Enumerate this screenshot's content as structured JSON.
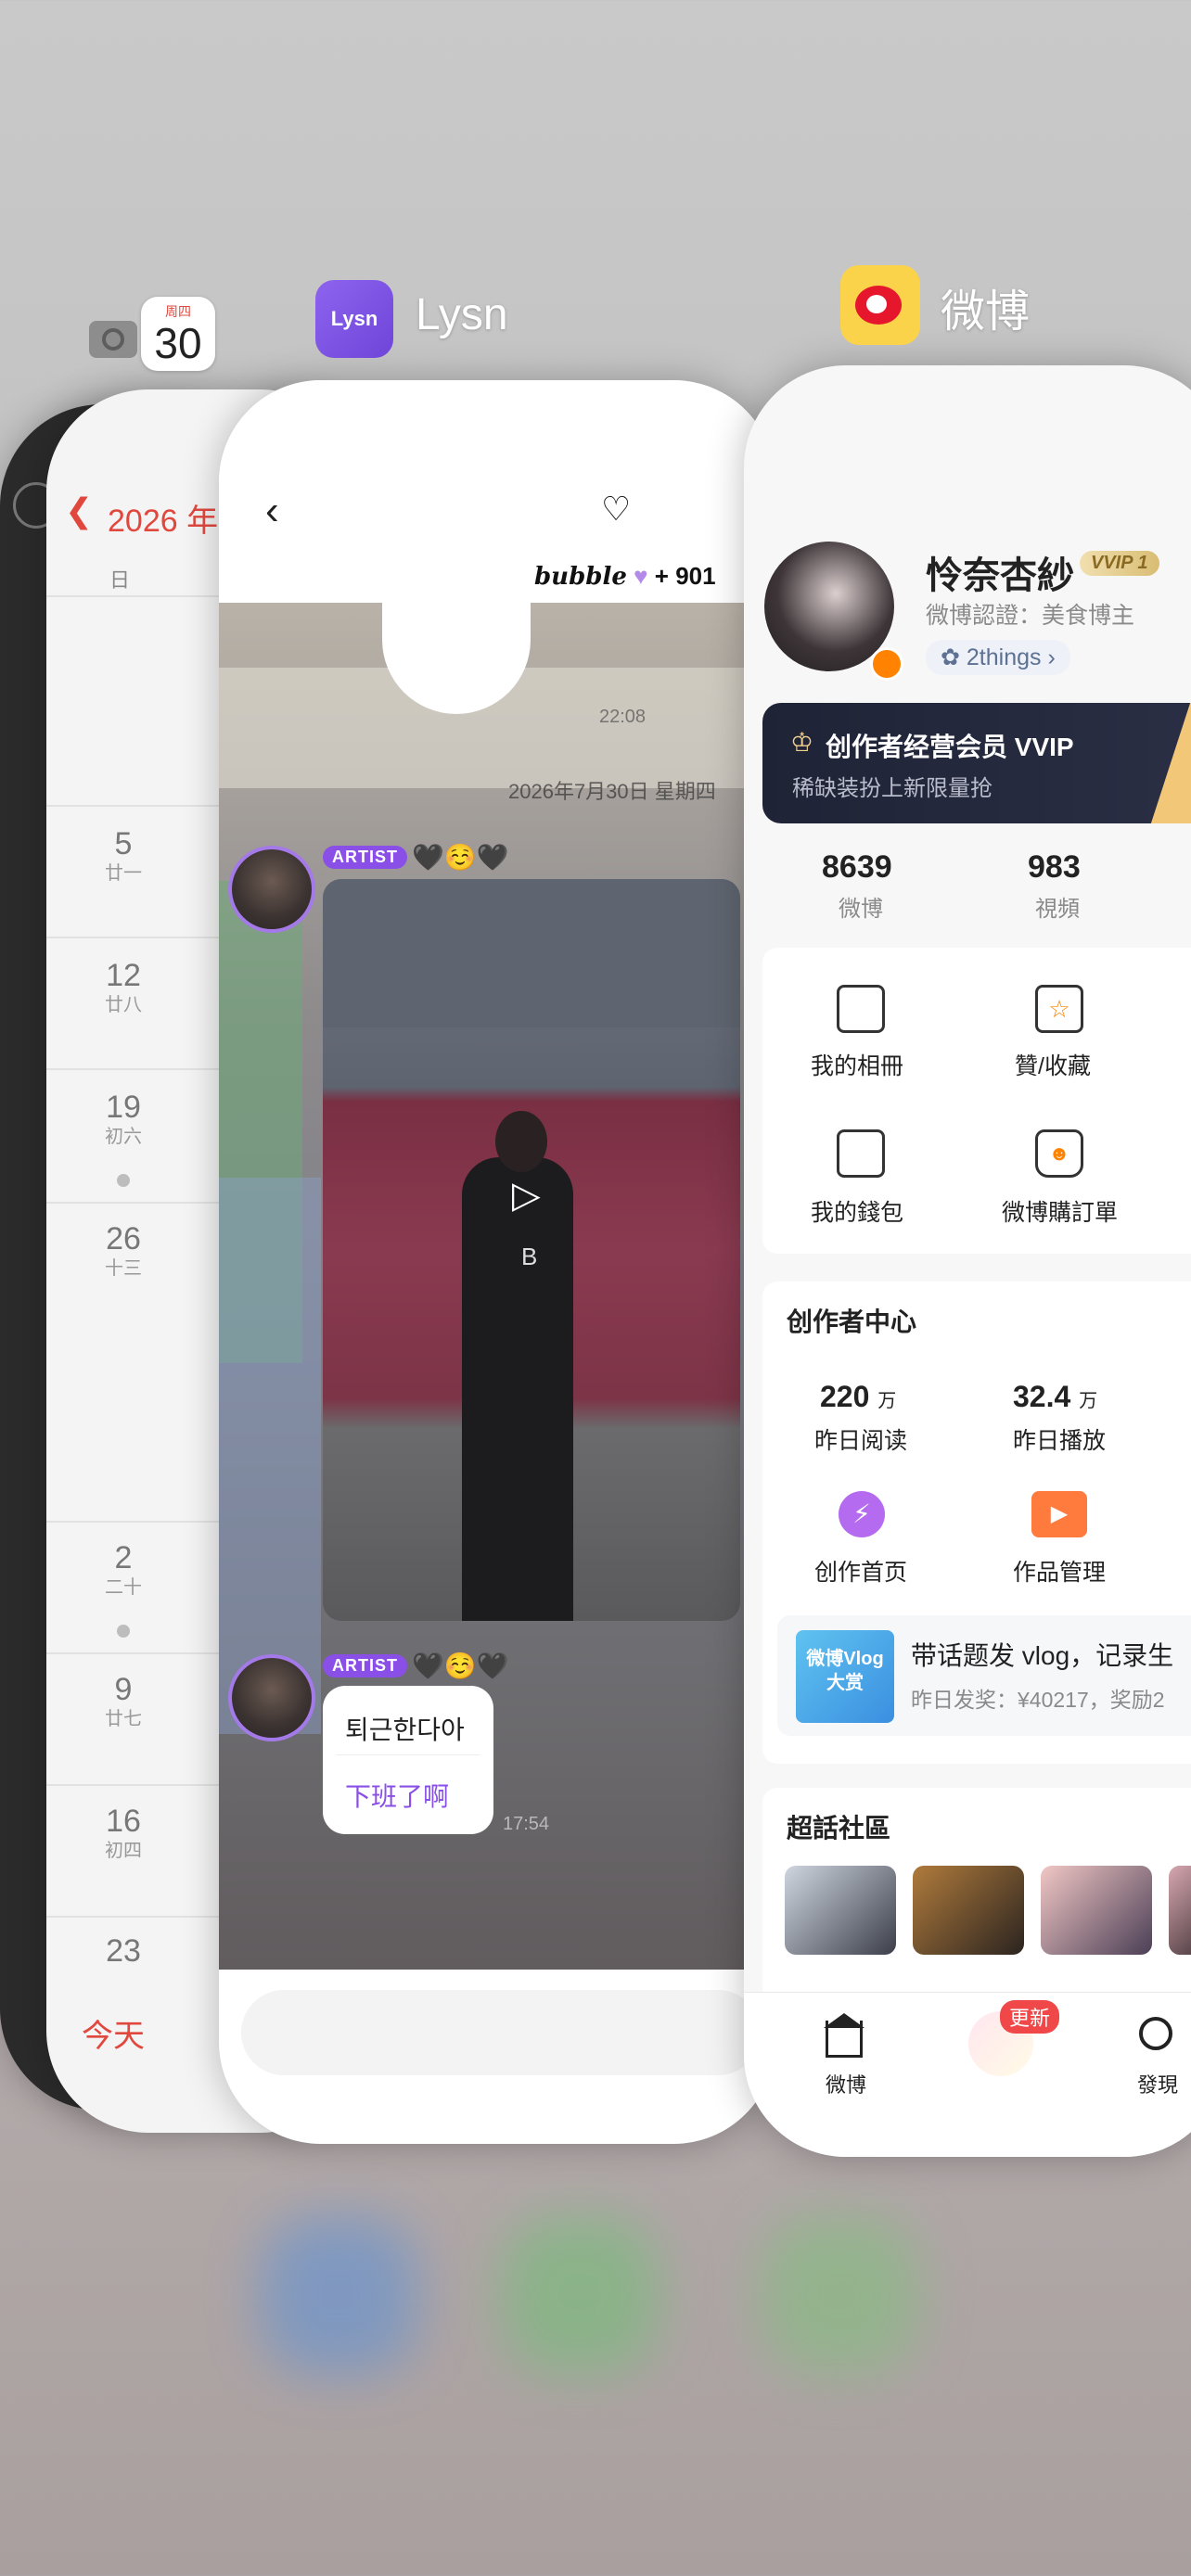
{
  "camera": {
    "app": "Camera"
  },
  "calendar": {
    "badge_weekday": "周四",
    "badge_day": "30",
    "header_year": "2026 年",
    "weekday_label": "日",
    "days": [
      {
        "num": "5",
        "lunar": "廿一",
        "dot": false
      },
      {
        "num": "12",
        "lunar": "廿八",
        "dot": false
      },
      {
        "num": "19",
        "lunar": "初六",
        "dot": true
      },
      {
        "num": "26",
        "lunar": "十三",
        "dot": false
      },
      {
        "num": "2",
        "lunar": "二十",
        "dot": true
      },
      {
        "num": "9",
        "lunar": "廿七",
        "dot": false
      },
      {
        "num": "16",
        "lunar": "初四",
        "dot": false
      },
      {
        "num": "23",
        "lunar": "",
        "dot": false
      }
    ],
    "today_button": "今天"
  },
  "lysn": {
    "app_label": "Lysn",
    "icon_text": "Lysn",
    "bubble_word": "bubble",
    "bubble_count": "+ 901",
    "timestamp_1": "22:08",
    "date_line": "2026年7月30日 星期四",
    "artist_tag": "ARTIST",
    "emoji_1": "🖤☺️🖤",
    "emoji_2": "🖤☺️🖤",
    "video_label": "B",
    "message_korean": "퇴근한다아",
    "message_translation": "下班了啊",
    "timestamp_2": "17:54"
  },
  "weibo": {
    "app_label": "微博",
    "profile": {
      "name": "怜奈杏紗",
      "vvip": "VVIP 1",
      "verify": "微博認證：美食博主",
      "group": "2things"
    },
    "vip_banner": {
      "title": "创作者经营会员 VVIP",
      "subtitle": "稀缺装扮上新限量抢"
    },
    "stats": [
      {
        "value": "8639",
        "label": "微博"
      },
      {
        "value": "983",
        "label": "視頻"
      }
    ],
    "menu": [
      {
        "label": "我的相冊",
        "icon": "photo-album-icon"
      },
      {
        "label": "贊/收藏",
        "icon": "star-bookmark-icon"
      },
      {
        "label": "我的錢包",
        "icon": "wallet-icon"
      },
      {
        "label": "微博購訂單",
        "icon": "shopping-bag-icon"
      }
    ],
    "creator": {
      "title": "创作者中心",
      "metrics": [
        {
          "value": "220",
          "unit": "万",
          "label": "昨日阅读"
        },
        {
          "value": "32.4",
          "unit": "万",
          "label": "昨日播放"
        }
      ],
      "actions": [
        {
          "label": "创作首页",
          "icon": "lightbulb-icon"
        },
        {
          "label": "作品管理",
          "icon": "video-manage-icon"
        }
      ],
      "promo_thumb": "微博Vlog 大赏",
      "promo_title": "带话题发 vlog，记录生",
      "promo_sub": "昨日发奖：¥40217，奖励2"
    },
    "supertopic": {
      "title": "超話社區"
    },
    "tabs": [
      {
        "label": "微博",
        "icon": "home-icon"
      },
      {
        "label": "更新",
        "icon": "wish-badge-icon"
      },
      {
        "label": "發現",
        "icon": "search-icon"
      }
    ],
    "brand_color": "#ff8200"
  }
}
